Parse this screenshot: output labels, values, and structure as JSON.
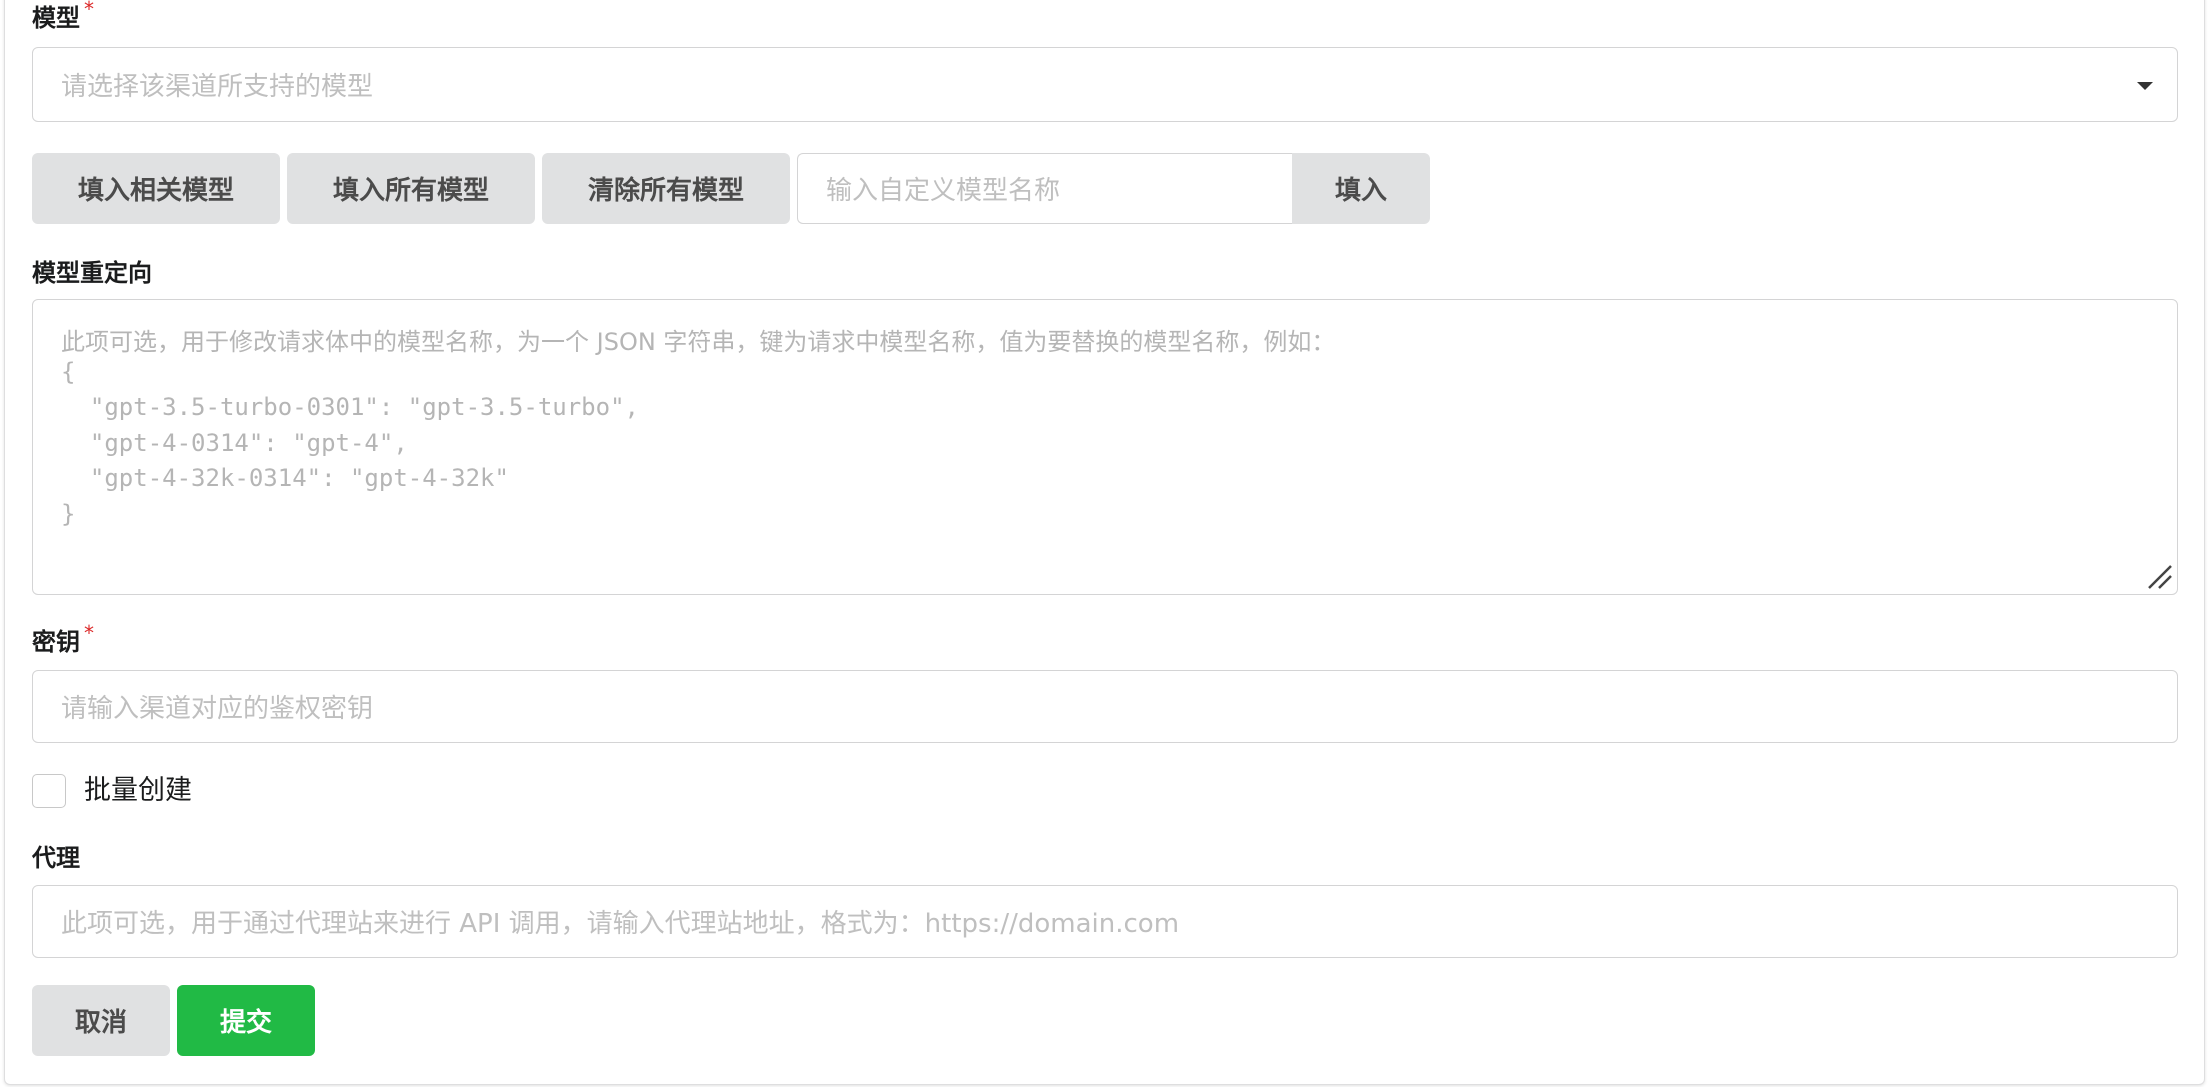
{
  "models": {
    "label": "模型",
    "required_mark": "*",
    "select_placeholder": "请选择该渠道所支持的模型"
  },
  "model_actions": {
    "fill_related": "填入相关模型",
    "fill_all": "填入所有模型",
    "clear_all": "清除所有模型",
    "custom_placeholder": "输入自定义模型名称",
    "fill_button": "填入"
  },
  "model_mapping": {
    "label": "模型重定向",
    "placeholder_lines": [
      "此项可选，用于修改请求体中的模型名称，为一个 JSON 字符串，键为请求中模型名称，值为要替换的模型名称，例如：",
      "{",
      "  \"gpt-3.5-turbo-0301\": \"gpt-3.5-turbo\",",
      "  \"gpt-4-0314\": \"gpt-4\",",
      "  \"gpt-4-32k-0314\": \"gpt-4-32k\"",
      "}"
    ]
  },
  "key": {
    "label": "密钥",
    "required_mark": "*",
    "placeholder": "请输入渠道对应的鉴权密钥"
  },
  "batch_create": {
    "label": "批量创建",
    "checked": false
  },
  "proxy": {
    "label": "代理",
    "placeholder": "此项可选，用于通过代理站来进行 API 调用，请输入代理站地址，格式为：https://domain.com"
  },
  "footer": {
    "cancel": "取消",
    "submit": "提交"
  },
  "colors": {
    "submit_green": "#21ba45",
    "button_grey": "#e0e1e2",
    "required_red": "#db2828"
  }
}
